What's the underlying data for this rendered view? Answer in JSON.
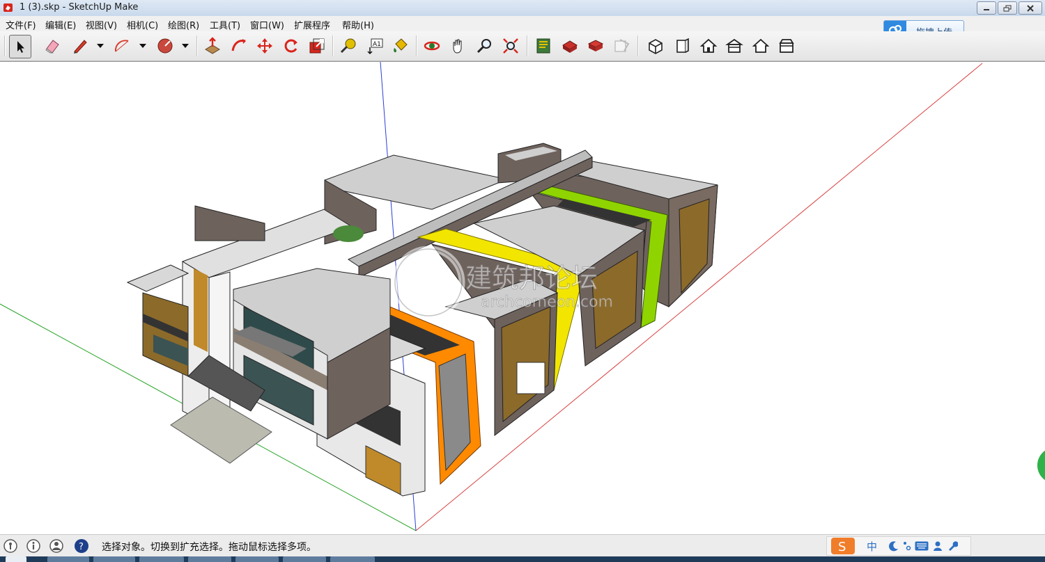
{
  "window": {
    "title": "1 (3).skp - SketchUp Make"
  },
  "menu": [
    "文件(F)",
    "编辑(E)",
    "视图(V)",
    "相机(C)",
    "绘图(R)",
    "工具(T)",
    "窗口(W)",
    "扩展程序",
    "帮助(H)"
  ],
  "upload_button": {
    "label": "拖拽上传"
  },
  "toolbar": {
    "tools": [
      "select-icon",
      "eraser-icon",
      "pencil-line-icon",
      "arc-icon",
      "shape-icon",
      "push-pull-icon",
      "follow-me-icon",
      "move-icon",
      "rotate-icon",
      "scale-icon",
      "tape-measure-icon",
      "text-icon",
      "paint-bucket-icon",
      "orbit-icon",
      "pan-icon",
      "zoom-icon",
      "zoom-extents-icon",
      "warehouse-icon",
      "extension-warehouse-icon",
      "share-model-icon",
      "layout-icon",
      "iso-view-icon",
      "front-view-icon",
      "top-view-icon",
      "right-view-icon",
      "back-view-icon",
      "left-view-icon"
    ]
  },
  "status": {
    "text": "选择对象。切换到扩充选择。拖动鼠标选择多项。"
  },
  "ime": {
    "label": "中"
  },
  "watermark": {
    "brand": "建筑邦论坛",
    "url": "archcomeon.com"
  },
  "colors": {
    "axis_red": "#d94040",
    "axis_green": "#2aa52a",
    "axis_blue": "#2b3fd6",
    "accent_orange": "#ff8a00",
    "accent_yellow": "#f2e600",
    "accent_green": "#8fd400",
    "wall_brown": "#6e625d",
    "roof_grey": "#cfcfcf"
  }
}
